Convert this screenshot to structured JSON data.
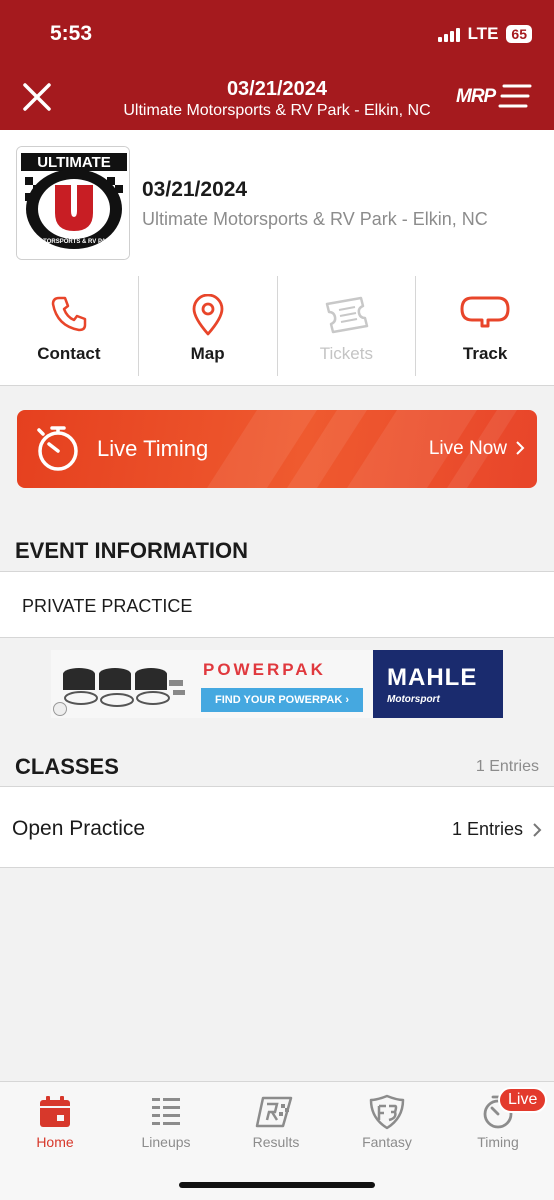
{
  "status_bar": {
    "time": "5:53",
    "network": "LTE",
    "battery": "65"
  },
  "header": {
    "date": "03/21/2024",
    "venue": "Ultimate Motorsports & RV Park - Elkin, NC",
    "brand": "MRP"
  },
  "event": {
    "logo_text_top": "ULTIMATE",
    "logo_letter": "U",
    "logo_text_ring": "MOTORSPORTS & RV PARK",
    "date": "03/21/2024",
    "venue": "Ultimate Motorsports & RV Park - Elkin, NC",
    "actions": [
      {
        "label": "Contact",
        "icon": "phone-icon",
        "enabled": true
      },
      {
        "label": "Map",
        "icon": "map-pin-icon",
        "enabled": true
      },
      {
        "label": "Tickets",
        "icon": "ticket-icon",
        "enabled": false
      },
      {
        "label": "Track",
        "icon": "track-icon",
        "enabled": true
      }
    ]
  },
  "live_timing": {
    "label": "Live Timing",
    "status": "Live Now"
  },
  "event_information": {
    "title": "EVENT INFORMATION",
    "text": "PRIVATE PRACTICE"
  },
  "ad": {
    "brand": "POWERPAK",
    "cta": "FIND YOUR POWERPAK ›",
    "sponsor": "MAHLE",
    "sponsor_sub": "Motorsport"
  },
  "classes": {
    "title": "CLASSES",
    "total": "1 Entries",
    "items": [
      {
        "name": "Open Practice",
        "entries": "1 Entries"
      }
    ]
  },
  "tabbar": {
    "tabs": [
      {
        "label": "Home",
        "icon": "calendar-icon",
        "active": true
      },
      {
        "label": "Lineups",
        "icon": "lineups-icon",
        "active": false
      },
      {
        "label": "Results",
        "icon": "results-icon",
        "active": false
      },
      {
        "label": "Fantasy",
        "icon": "fantasy-icon",
        "active": false
      },
      {
        "label": "Timing",
        "icon": "timing-icon",
        "active": false
      }
    ],
    "live_badge": "Live"
  },
  "colors": {
    "brand_red": "#a51a1e",
    "accent_orange": "#e5401f",
    "active_tab": "#d7382b",
    "muted_text": "#8c8c8c"
  }
}
